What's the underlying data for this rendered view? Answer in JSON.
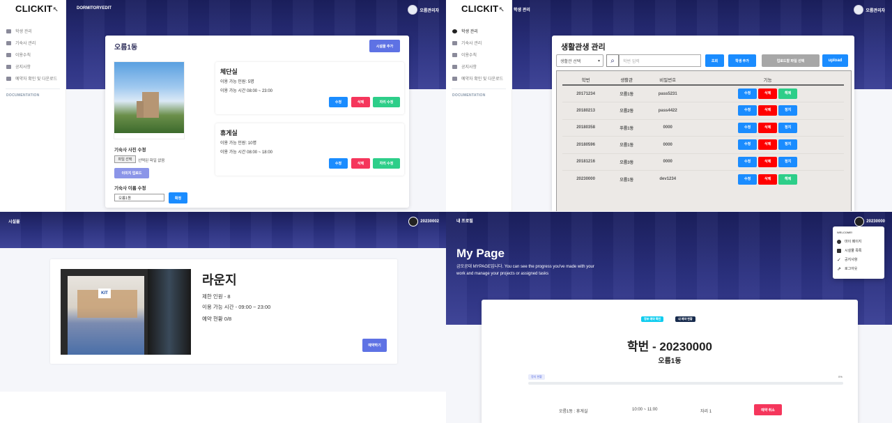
{
  "panel1": {
    "brand": "CLICKIT",
    "topbar_title": "DORMITORYEDIT",
    "user": "오름관리자",
    "nav": [
      "학생 관리",
      "기숙사 관리",
      "이용수칙",
      "공지사항",
      "예약자 확인 및 다운로드"
    ],
    "doc": "DOCUMENTATION",
    "card_title": "오름1동",
    "add_facility": "시설물 추가",
    "photo_edit_label": "기숙사 사진 수정",
    "file_button": "파일 선택",
    "file_status": "선택된 파일 없음",
    "upload_image": "이미지 업로드",
    "name_edit_label": "기숙사 이름 수정",
    "name_value": "오름1동",
    "name_confirm": "확정",
    "rooms": [
      {
        "name": "체단실",
        "capacity": "이용 가능 인원: 5명",
        "hours": "이용 가능 시간 08:00 ~ 23:00",
        "edit": "수정",
        "delete": "삭제",
        "seat_edit": "자리 수정"
      },
      {
        "name": "휴게실",
        "capacity": "이용 가능 인원: 10명",
        "hours": "이용 가능 시간 08:00 ~ 18:00",
        "edit": "수정",
        "delete": "삭제",
        "seat_edit": "자리 수정"
      }
    ]
  },
  "panel2": {
    "brand": "CLICKIT",
    "topbar_title": "학생 관리",
    "user": "오름관리자",
    "nav": [
      "학생 관리",
      "기숙사 관리",
      "이용수칙",
      "공지사항",
      "예약자 확인 및 다운로드"
    ],
    "doc": "DOCUMENTATION",
    "card_title": "생활관생 관리",
    "select_value": "생활관 선택",
    "search_placeholder": "학번 입력",
    "search_button": "조회",
    "add_student": "학생 추가",
    "file_select": "업로드할 파일 선택",
    "upload": "upload",
    "headers": [
      "학번",
      "생활관",
      "비밀번호",
      "기능"
    ],
    "rows": [
      {
        "id": "20171234",
        "dorm": "오름1동",
        "pw": "pass5231",
        "a": "수정",
        "b": "삭제",
        "c": "해제",
        "c_color": "green"
      },
      {
        "id": "20180213",
        "dorm": "오름2동",
        "pw": "pass4422",
        "a": "수정",
        "b": "삭제",
        "c": "정지",
        "c_color": "blue"
      },
      {
        "id": "20180358",
        "dorm": "푸름1동",
        "pw": "0000",
        "a": "수정",
        "b": "삭제",
        "c": "정지",
        "c_color": "blue"
      },
      {
        "id": "20180596",
        "dorm": "오름1동",
        "pw": "0000",
        "a": "수정",
        "b": "삭제",
        "c": "정지",
        "c_color": "blue"
      },
      {
        "id": "20181216",
        "dorm": "오름3동",
        "pw": "0000",
        "a": "수정",
        "b": "삭제",
        "c": "정지",
        "c_color": "blue"
      },
      {
        "id": "20230000",
        "dorm": "오름1동",
        "pw": "dev1234",
        "a": "수정",
        "b": "삭제",
        "c": "해제",
        "c_color": "green"
      }
    ]
  },
  "panel3": {
    "topbar_title": "시설물",
    "user": "20230002",
    "room_name": "라운지",
    "limit": "제한 인원 - 8",
    "hours": "이용 가능 시간 - 09:00 ~ 23:00",
    "status": "예약 현황 0/8",
    "reserve": "예약하기",
    "sign_text": "KIT"
  },
  "panel4": {
    "topbar_title": "내 프로필",
    "user": "20230000",
    "heading": "My Page",
    "intro": "금오공대 MYPAGE입니다. You can see the progress you've made with your work and manage your projects or assigned tasks",
    "dropdown": {
      "welcome": "WELCOME!",
      "items": [
        "마이 페이지",
        "시설물 목록",
        "공지사항",
        "로그아웃"
      ]
    },
    "tab_a": "정보 예약 확인",
    "tab_b": "내 예약 현황",
    "student": "학번 - 20230000",
    "dorm": "오름1동",
    "progress_label": "정지 현황",
    "progress_pct": "0%",
    "reservation": {
      "place": "오름1동 : 휴게실",
      "time": "10:00 ~ 11:00",
      "seat": "자리 1",
      "cancel": "예약 취소"
    }
  }
}
